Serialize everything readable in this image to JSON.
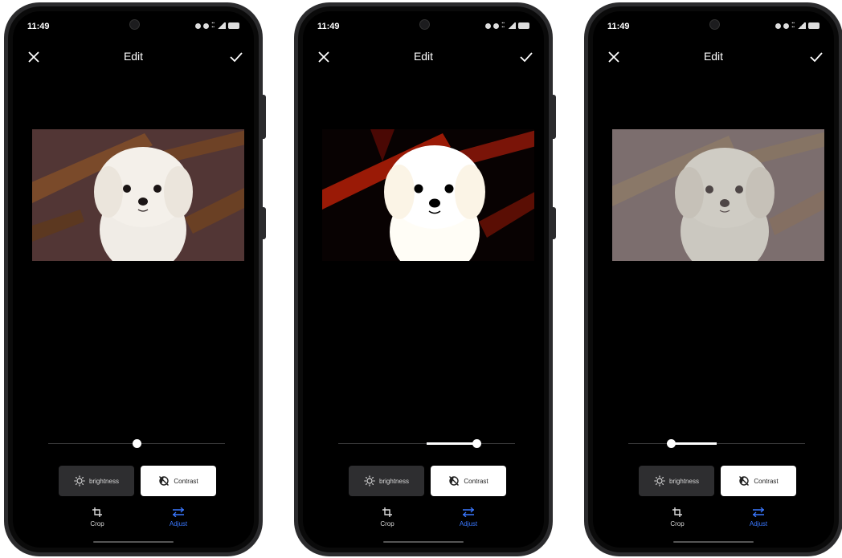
{
  "screens": [
    {
      "status": {
        "time": "11:49"
      },
      "title": "Edit",
      "buttons": {
        "brightness": "brightness",
        "contrast": "Contrast"
      },
      "nav": {
        "crop": "Crop",
        "adjust": "Adjust"
      },
      "slider": {
        "start": 0.5,
        "value": 0.5
      },
      "photo_variant": "normal"
    },
    {
      "status": {
        "time": "11:49"
      },
      "title": "Edit",
      "buttons": {
        "brightness": "brightness",
        "contrast": "Contrast"
      },
      "nav": {
        "crop": "Crop",
        "adjust": "Adjust"
      },
      "slider": {
        "start": 0.5,
        "value": 0.78
      },
      "photo_variant": "high-contrast"
    },
    {
      "status": {
        "time": "11:49"
      },
      "title": "Edit",
      "buttons": {
        "brightness": "brightness",
        "contrast": "Contrast"
      },
      "nav": {
        "crop": "Crop",
        "adjust": "Adjust"
      },
      "slider": {
        "start": 0.5,
        "value": 0.24
      },
      "photo_variant": "low-contrast"
    }
  ],
  "icons": {
    "close": "close-icon",
    "confirm": "checkmark-icon",
    "brightness": "sun-icon",
    "contrast": "contrast-icon",
    "crop": "crop-icon",
    "adjust": "sliders-icon"
  },
  "colors": {
    "accent": "#3a78ff",
    "screen_bg": "#000000",
    "selected_button": "#ffffff",
    "unselected_button": "#2e2e30"
  }
}
